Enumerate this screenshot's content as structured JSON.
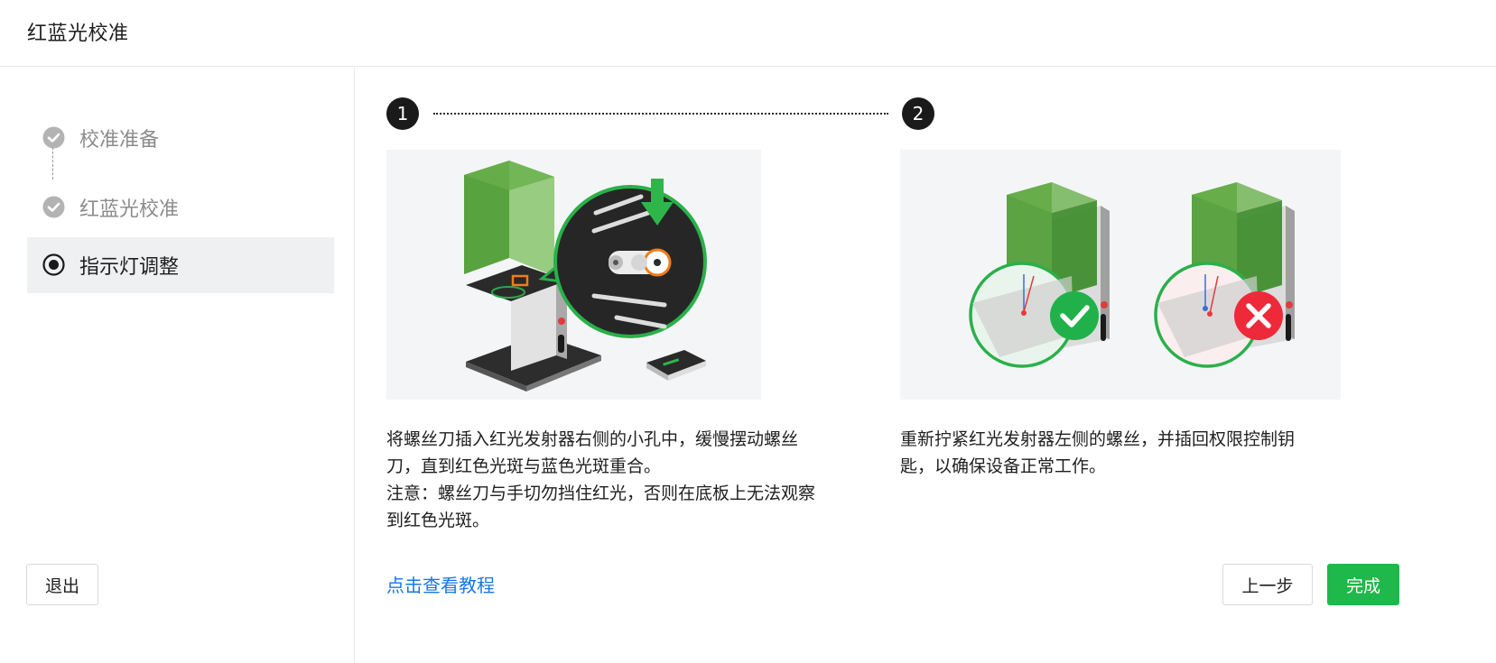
{
  "header": {
    "title": "红蓝光校准"
  },
  "sidebar": {
    "steps": [
      {
        "label": "校准准备",
        "status": "done"
      },
      {
        "label": "红蓝光校准",
        "status": "done"
      },
      {
        "label": "指示灯调整",
        "status": "current"
      }
    ],
    "exit_label": "退出"
  },
  "main": {
    "step_numbers": [
      "1",
      "2"
    ],
    "step1": {
      "description": "将螺丝刀插入红光发射器右侧的小孔中，缓慢摆动螺丝刀，直到红色光斑与蓝色光斑重合。",
      "note": "注意：螺丝刀与手切勿挡住红光，否则在底板上无法观察到红色光斑。"
    },
    "step2": {
      "description": "重新拧紧红光发射器左侧的螺丝，并插回权限控制钥匙，以确保设备正常工作。"
    },
    "tutorial_link": "点击查看教程"
  },
  "footer": {
    "prev_label": "上一步",
    "finish_label": "完成"
  },
  "colors": {
    "accent_green": "#1fb84a",
    "link_blue": "#1677e6",
    "error_red": "#ee2a3a"
  }
}
